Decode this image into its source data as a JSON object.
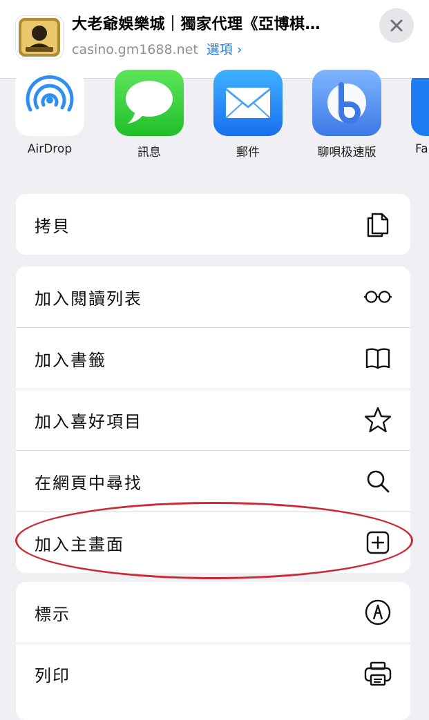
{
  "header": {
    "title": "大老爺娛樂城｜獨家代理《亞博棋…",
    "url": "casino.gm1688.net",
    "options_label": "選項 ›"
  },
  "apps": [
    {
      "label": "AirDrop",
      "icon": "airdrop-icon"
    },
    {
      "label": "訊息",
      "icon": "messages-icon"
    },
    {
      "label": "郵件",
      "icon": "mail-icon"
    },
    {
      "label": "聊唄极速版",
      "icon": "liaobei-icon"
    },
    {
      "label": "Fa",
      "icon": "app-icon"
    }
  ],
  "menu": {
    "copy": "拷貝",
    "reading_list": "加入閱讀列表",
    "bookmark": "加入書籤",
    "favorites": "加入喜好項目",
    "find": "在網頁中尋找",
    "home_screen": "加入主畫面",
    "markup": "標示",
    "print": "列印"
  },
  "colors": {
    "accent": "#1f7ae0",
    "highlight_ellipse": "#cc2a36",
    "sheet_background": "#efeff4"
  }
}
